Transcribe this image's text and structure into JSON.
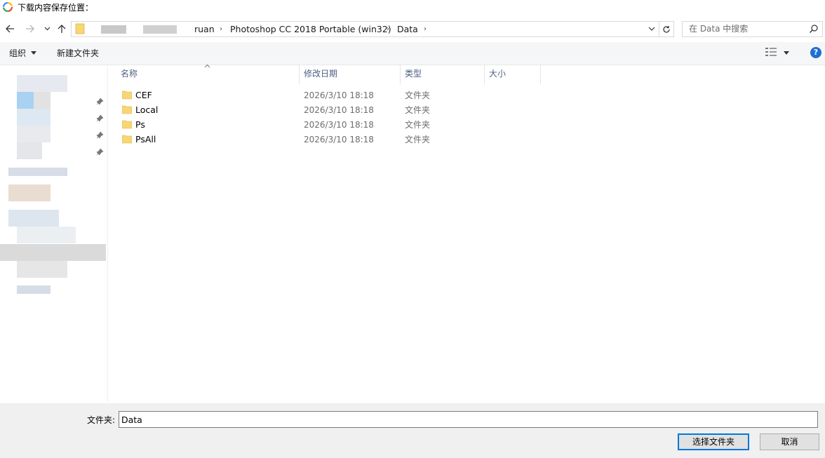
{
  "window": {
    "title": "下载内容保存位置："
  },
  "address": {
    "crumbs": [
      "ruan",
      "Photoshop CC 2018 Portable (win32)",
      "Data"
    ]
  },
  "search": {
    "placeholder": "在 Data 中搜索"
  },
  "toolbar": {
    "organize_label": "组织",
    "new_folder_label": "新建文件夹"
  },
  "columns": {
    "name": "名称",
    "modified": "修改日期",
    "type": "类型",
    "size": "大小"
  },
  "files": [
    {
      "name": "CEF",
      "modified": "2026/3/10 18:18",
      "type": "文件夹"
    },
    {
      "name": "Local",
      "modified": "2026/3/10 18:18",
      "type": "文件夹"
    },
    {
      "name": "Ps",
      "modified": "2026/3/10 18:18",
      "type": "文件夹"
    },
    {
      "name": "PsAll",
      "modified": "2026/3/10 18:18",
      "type": "文件夹"
    }
  ],
  "footer": {
    "folder_label": "文件夹:",
    "folder_value": "Data",
    "select_button": "选择文件夹",
    "cancel_button": "取消"
  },
  "colors": {
    "accent": "#0078d7",
    "help": "#1f6fd1",
    "folder": "#f7d674"
  }
}
